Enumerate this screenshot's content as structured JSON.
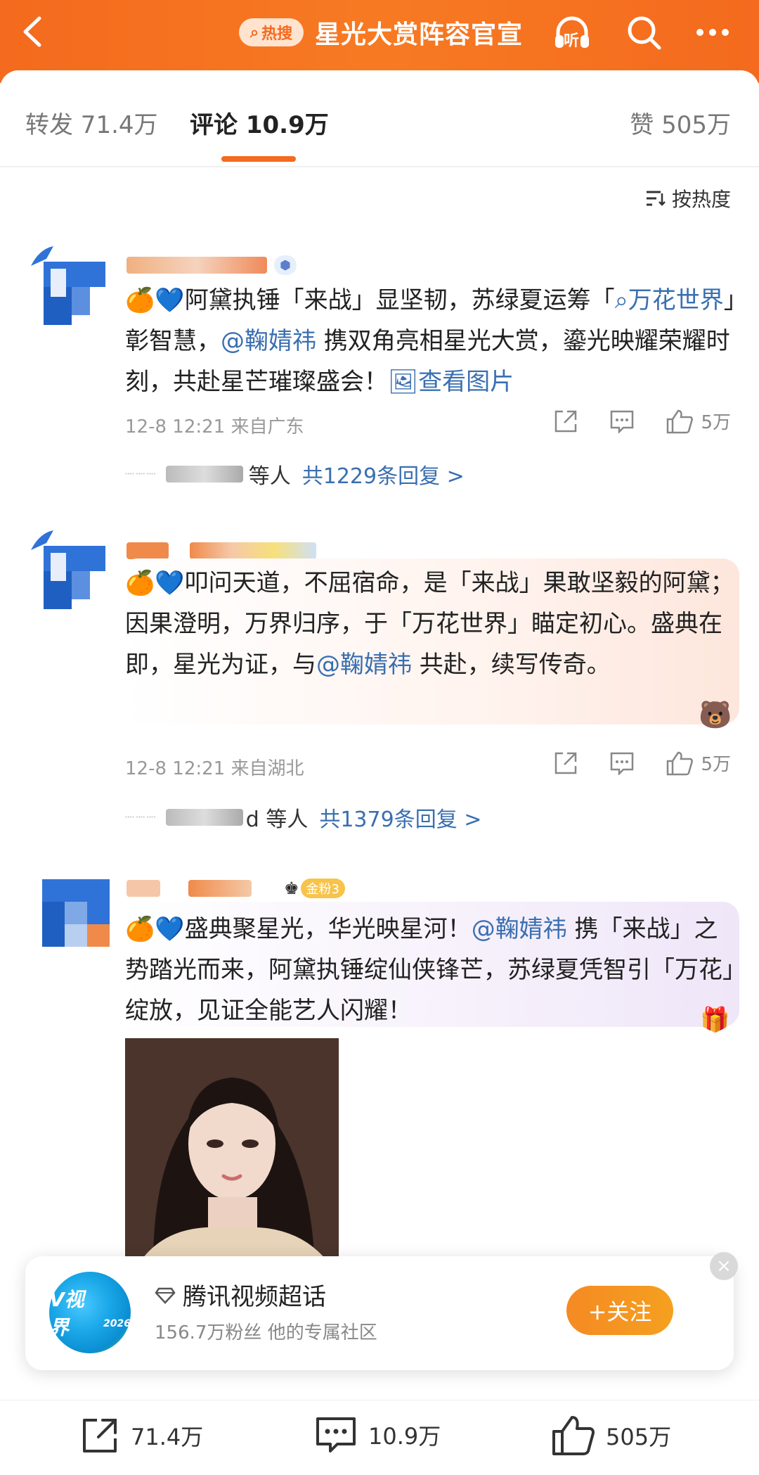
{
  "header": {
    "hot_badge": "热搜",
    "title": "星光大赏阵容官宣",
    "icons": [
      "back-arrow-icon",
      "listen-headphone-icon",
      "search-icon",
      "more-icon"
    ],
    "listen_label": "听"
  },
  "stats": {
    "repost": "转发 71.4万",
    "comments": "评论 10.9万",
    "likes": "赞 505万"
  },
  "sort": {
    "label": "按热度"
  },
  "comments": [
    {
      "text_pre": "阿黛执锤「来战」显坚韧，苏绿夏运筹「",
      "link": "万花世界",
      "text_mid": "」彰智慧，",
      "mention": "@鞠婧祎",
      "text_post": " 携双角亮相星光大赏，鎏光映耀荣耀时刻，共赴星芒璀璨盛会！",
      "view_image": "查看图片",
      "time_location": "12-8 12:21 来自广东",
      "likes": "5万",
      "replies_who": "等人",
      "replies_count": "共1229条回复 >"
    },
    {
      "text_pre": "叩问天道，不屈宿命，是「来战」果敢坚毅的阿黛；因果澄明，万界归序，于「万花世界」瞄定初心。盛典在即，星光为证，与",
      "mention": "@鞠婧祎",
      "text_post": " 共赴，续写传奇。",
      "time_location": "12-8 12:21 来自湖北",
      "likes": "5万",
      "replies_who": "d 等人",
      "replies_count": "共1379条回复 >"
    },
    {
      "badge": "金粉3",
      "text_pre": "盛典聚星光，华光映星河！",
      "mention": "@鞠婧祎",
      "text_post": " 携「来战」之势踏光而来，阿黛执锤绽仙侠锋芒，苏绿夏凭智引「万花」绽放，见证全能艺人闪耀！"
    }
  ],
  "follow_card": {
    "logo_text": "V视界",
    "logo_year": "2026",
    "title": "腾讯视频超话",
    "subtitle": "156.7万粉丝 他的专属社区",
    "button": "+关注",
    "close": "×"
  },
  "bottom_bar": {
    "repost": "71.4万",
    "comment": "10.9万",
    "like": "505万"
  },
  "colors": {
    "header_orange": "#f46a1e",
    "link_blue": "#3a6fb0",
    "follow_button": "#f5921f"
  }
}
